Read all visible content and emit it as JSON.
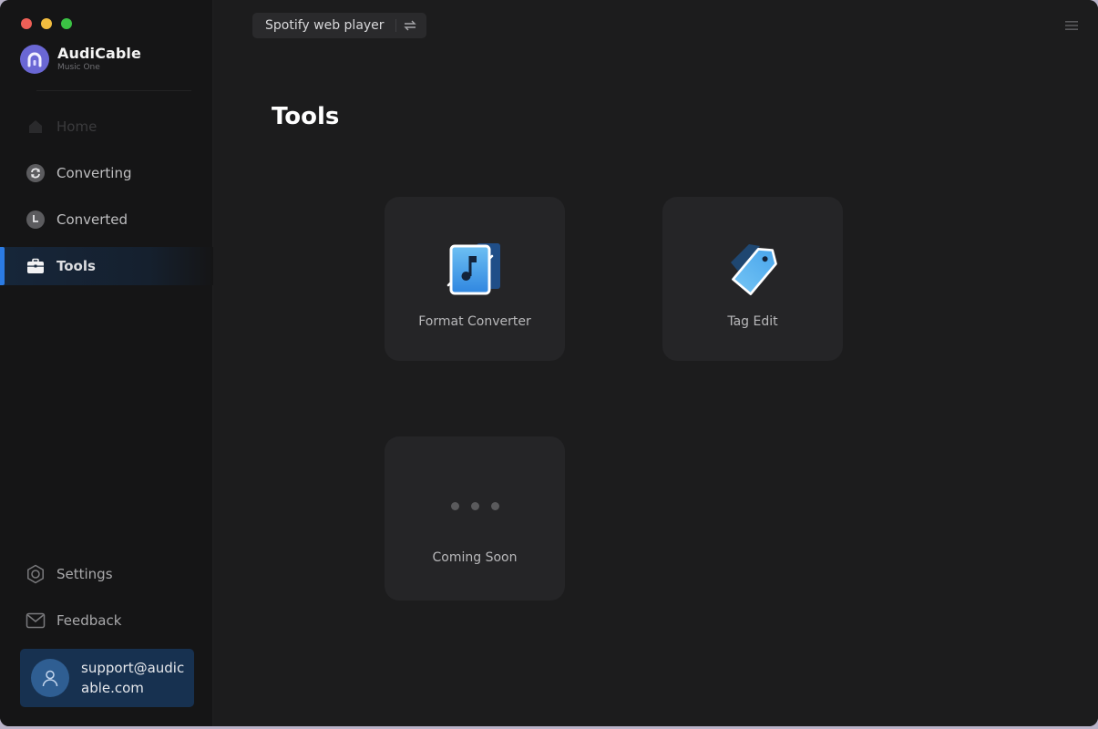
{
  "app": {
    "name": "AudiCable",
    "subtitle": "Music One"
  },
  "window_controls": [
    "close",
    "minimize",
    "maximize"
  ],
  "sidebar": {
    "items": [
      {
        "label": "Home",
        "icon": "home-icon",
        "state": "disabled"
      },
      {
        "label": "Converting",
        "icon": "converting-icon",
        "state": "normal"
      },
      {
        "label": "Converted",
        "icon": "clock-icon",
        "state": "normal"
      },
      {
        "label": "Tools",
        "icon": "toolbox-icon",
        "state": "active"
      }
    ],
    "bottom_items": [
      {
        "label": "Settings",
        "icon": "settings-icon"
      },
      {
        "label": "Feedback",
        "icon": "mail-icon"
      }
    ],
    "account": {
      "email": "support@audicable.com",
      "icon": "user-icon"
    }
  },
  "header": {
    "source_label": "Spotify web player",
    "swap_icon": "swap-icon",
    "menu_icon": "hamburger-menu-icon"
  },
  "main": {
    "title": "Tools",
    "tools": [
      {
        "label": "Format Converter",
        "icon": "format-converter-icon"
      },
      {
        "label": "Tag Edit",
        "icon": "tag-icon"
      },
      {
        "label": "Coming Soon",
        "icon": "more-dots-icon"
      }
    ]
  },
  "colors": {
    "accent": "#2b7be4",
    "brand": "#6a67d4",
    "active_bg": "#16263a",
    "account_bg": "#173150"
  }
}
